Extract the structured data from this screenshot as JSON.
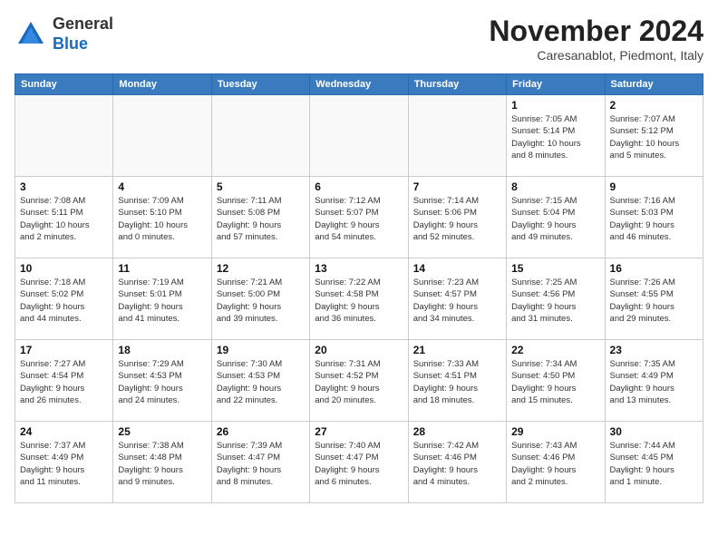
{
  "header": {
    "logo_line1": "General",
    "logo_line2": "Blue",
    "month": "November 2024",
    "location": "Caresanablot, Piedmont, Italy"
  },
  "weekdays": [
    "Sunday",
    "Monday",
    "Tuesday",
    "Wednesday",
    "Thursday",
    "Friday",
    "Saturday"
  ],
  "weeks": [
    [
      {
        "day": "",
        "info": ""
      },
      {
        "day": "",
        "info": ""
      },
      {
        "day": "",
        "info": ""
      },
      {
        "day": "",
        "info": ""
      },
      {
        "day": "",
        "info": ""
      },
      {
        "day": "1",
        "info": "Sunrise: 7:05 AM\nSunset: 5:14 PM\nDaylight: 10 hours\nand 8 minutes."
      },
      {
        "day": "2",
        "info": "Sunrise: 7:07 AM\nSunset: 5:12 PM\nDaylight: 10 hours\nand 5 minutes."
      }
    ],
    [
      {
        "day": "3",
        "info": "Sunrise: 7:08 AM\nSunset: 5:11 PM\nDaylight: 10 hours\nand 2 minutes."
      },
      {
        "day": "4",
        "info": "Sunrise: 7:09 AM\nSunset: 5:10 PM\nDaylight: 10 hours\nand 0 minutes."
      },
      {
        "day": "5",
        "info": "Sunrise: 7:11 AM\nSunset: 5:08 PM\nDaylight: 9 hours\nand 57 minutes."
      },
      {
        "day": "6",
        "info": "Sunrise: 7:12 AM\nSunset: 5:07 PM\nDaylight: 9 hours\nand 54 minutes."
      },
      {
        "day": "7",
        "info": "Sunrise: 7:14 AM\nSunset: 5:06 PM\nDaylight: 9 hours\nand 52 minutes."
      },
      {
        "day": "8",
        "info": "Sunrise: 7:15 AM\nSunset: 5:04 PM\nDaylight: 9 hours\nand 49 minutes."
      },
      {
        "day": "9",
        "info": "Sunrise: 7:16 AM\nSunset: 5:03 PM\nDaylight: 9 hours\nand 46 minutes."
      }
    ],
    [
      {
        "day": "10",
        "info": "Sunrise: 7:18 AM\nSunset: 5:02 PM\nDaylight: 9 hours\nand 44 minutes."
      },
      {
        "day": "11",
        "info": "Sunrise: 7:19 AM\nSunset: 5:01 PM\nDaylight: 9 hours\nand 41 minutes."
      },
      {
        "day": "12",
        "info": "Sunrise: 7:21 AM\nSunset: 5:00 PM\nDaylight: 9 hours\nand 39 minutes."
      },
      {
        "day": "13",
        "info": "Sunrise: 7:22 AM\nSunset: 4:58 PM\nDaylight: 9 hours\nand 36 minutes."
      },
      {
        "day": "14",
        "info": "Sunrise: 7:23 AM\nSunset: 4:57 PM\nDaylight: 9 hours\nand 34 minutes."
      },
      {
        "day": "15",
        "info": "Sunrise: 7:25 AM\nSunset: 4:56 PM\nDaylight: 9 hours\nand 31 minutes."
      },
      {
        "day": "16",
        "info": "Sunrise: 7:26 AM\nSunset: 4:55 PM\nDaylight: 9 hours\nand 29 minutes."
      }
    ],
    [
      {
        "day": "17",
        "info": "Sunrise: 7:27 AM\nSunset: 4:54 PM\nDaylight: 9 hours\nand 26 minutes."
      },
      {
        "day": "18",
        "info": "Sunrise: 7:29 AM\nSunset: 4:53 PM\nDaylight: 9 hours\nand 24 minutes."
      },
      {
        "day": "19",
        "info": "Sunrise: 7:30 AM\nSunset: 4:53 PM\nDaylight: 9 hours\nand 22 minutes."
      },
      {
        "day": "20",
        "info": "Sunrise: 7:31 AM\nSunset: 4:52 PM\nDaylight: 9 hours\nand 20 minutes."
      },
      {
        "day": "21",
        "info": "Sunrise: 7:33 AM\nSunset: 4:51 PM\nDaylight: 9 hours\nand 18 minutes."
      },
      {
        "day": "22",
        "info": "Sunrise: 7:34 AM\nSunset: 4:50 PM\nDaylight: 9 hours\nand 15 minutes."
      },
      {
        "day": "23",
        "info": "Sunrise: 7:35 AM\nSunset: 4:49 PM\nDaylight: 9 hours\nand 13 minutes."
      }
    ],
    [
      {
        "day": "24",
        "info": "Sunrise: 7:37 AM\nSunset: 4:49 PM\nDaylight: 9 hours\nand 11 minutes."
      },
      {
        "day": "25",
        "info": "Sunrise: 7:38 AM\nSunset: 4:48 PM\nDaylight: 9 hours\nand 9 minutes."
      },
      {
        "day": "26",
        "info": "Sunrise: 7:39 AM\nSunset: 4:47 PM\nDaylight: 9 hours\nand 8 minutes."
      },
      {
        "day": "27",
        "info": "Sunrise: 7:40 AM\nSunset: 4:47 PM\nDaylight: 9 hours\nand 6 minutes."
      },
      {
        "day": "28",
        "info": "Sunrise: 7:42 AM\nSunset: 4:46 PM\nDaylight: 9 hours\nand 4 minutes."
      },
      {
        "day": "29",
        "info": "Sunrise: 7:43 AM\nSunset: 4:46 PM\nDaylight: 9 hours\nand 2 minutes."
      },
      {
        "day": "30",
        "info": "Sunrise: 7:44 AM\nSunset: 4:45 PM\nDaylight: 9 hours\nand 1 minute."
      }
    ]
  ]
}
